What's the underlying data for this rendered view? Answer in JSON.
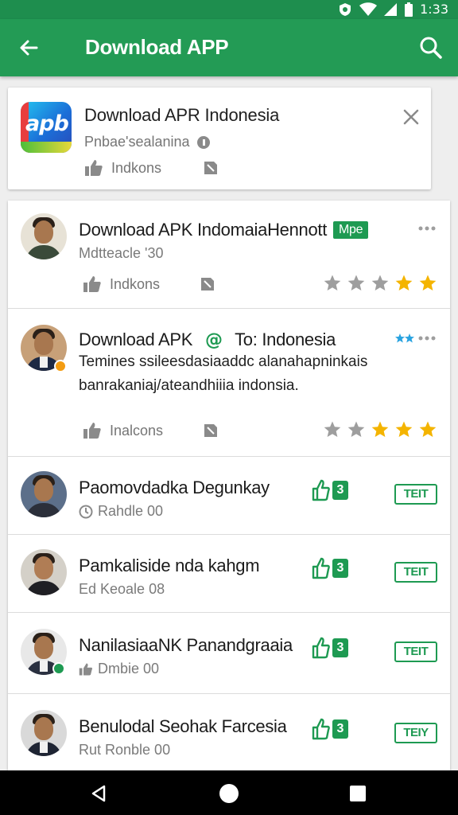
{
  "status_bar": {
    "time": "1:33"
  },
  "app_bar": {
    "title": "Download APP"
  },
  "app_card": {
    "title": "Download APR Indonesia",
    "subtitle": "Pnbae'sealanina",
    "meta_label": "Indkons"
  },
  "rows": [
    {
      "name": "Download APK IndomaiaHennott",
      "tag": "Mpe",
      "sub": "Mdtteacle '30",
      "meta_label": "Indkons",
      "rating": {
        "filled": 2,
        "total": 5,
        "color": "#f4b400"
      }
    },
    {
      "name": "Download APK",
      "name_suffix": "To: Indonesia",
      "desc_line1": "Temines ssileesdasiaaddc alanahapninkais",
      "desc_line2": "banrakaniaj/ateandhiiia indonsia.",
      "meta_label": "Inalcons",
      "rating": {
        "filled": 3,
        "total": 5,
        "color": "#f4b400"
      }
    },
    {
      "name": "Paomovdadka Degunkay",
      "sub": "Rahdle 00",
      "count": "3",
      "button": "TEIT"
    },
    {
      "name": "Pamkaliside nda kahgm",
      "sub": "Ed Keoale 08",
      "count": "3",
      "button": "TEIT"
    },
    {
      "name": "NanilasiaaNK Panandgraaia",
      "sub": "Dmbie 00",
      "count": "3",
      "button": "TEIT"
    },
    {
      "name": "Benulodal Seohak Farcesia",
      "sub": "Rut Ronble 00",
      "count": "3",
      "button": "TEIY"
    }
  ],
  "colors": {
    "brand": "#239b55",
    "accent": "#1e9a52",
    "star": "#f4b400"
  },
  "icons": [
    "back-arrow-icon",
    "search-icon",
    "close-icon",
    "thumbs-up-icon",
    "bookmark-icon",
    "more-icon",
    "star-icon",
    "nav-back-icon",
    "nav-home-icon",
    "nav-recent-icon"
  ]
}
